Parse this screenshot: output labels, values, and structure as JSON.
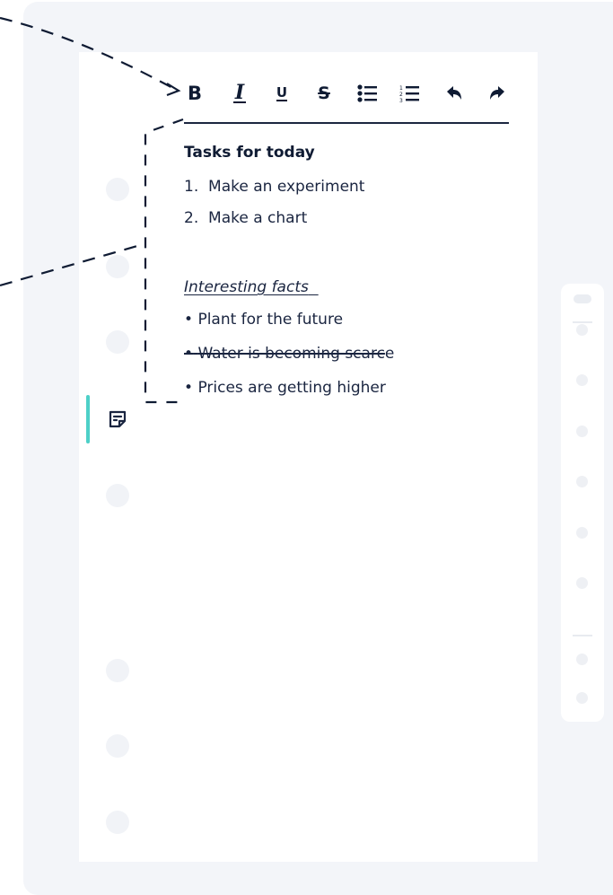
{
  "toolbar": {
    "buttons": [
      {
        "name": "bold-button",
        "icon": "bold-icon",
        "glyph": "B"
      },
      {
        "name": "italic-button",
        "icon": "italic-icon",
        "glyph": "I"
      },
      {
        "name": "underline-button",
        "icon": "underline-icon",
        "glyph": "U"
      },
      {
        "name": "strikethrough-button",
        "icon": "strikethrough-icon",
        "glyph": "S"
      },
      {
        "name": "bullet-list-button",
        "icon": "bullet-list-icon"
      },
      {
        "name": "numbered-list-button",
        "icon": "numbered-list-icon"
      },
      {
        "name": "undo-button",
        "icon": "undo-icon"
      },
      {
        "name": "redo-button",
        "icon": "redo-icon"
      }
    ]
  },
  "note": {
    "title": "Tasks for today",
    "tasks": [
      {
        "number": "1.",
        "text": "Make an experiment"
      },
      {
        "number": "2.",
        "text": "Make a chart"
      }
    ],
    "facts_heading": "Interesting facts",
    "facts": [
      {
        "bullet": "•",
        "text": "Plant for the future",
        "struck_part": "",
        "tail": ""
      },
      {
        "bullet": "•",
        "text": "",
        "struck_part": "Water is becoming scarc",
        "tail": "e"
      },
      {
        "bullet": "•",
        "text": "Prices are getting higher",
        "struck_part": "",
        "tail": ""
      }
    ]
  },
  "sidebar": {
    "active_item_icon": "note-icon"
  },
  "colors": {
    "accent": "#4dd0c8",
    "text": "#1a2540",
    "panel": "#f3f5f9",
    "dot": "#f1f3f7"
  }
}
